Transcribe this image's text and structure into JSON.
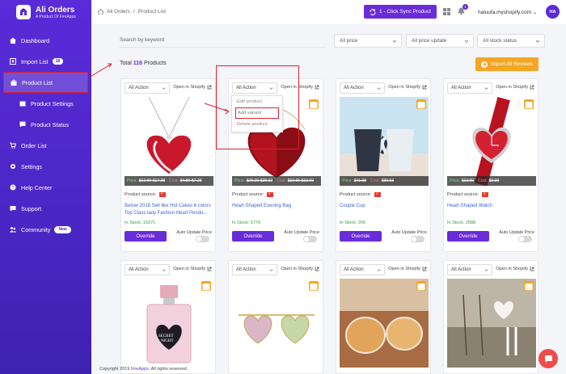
{
  "brand": {
    "title": "Ali Orders",
    "subtitle": "A Product Of FireApps"
  },
  "sidebar": {
    "items": [
      {
        "label": "Dashboard"
      },
      {
        "label": "Import List",
        "badge": "18"
      },
      {
        "label": "Product List"
      },
      {
        "label": "Product Settings"
      },
      {
        "label": "Product Status"
      },
      {
        "label": "Order List"
      },
      {
        "label": "Settings"
      },
      {
        "label": "Help Center"
      },
      {
        "label": "Support"
      },
      {
        "label": "Community",
        "badge": "New"
      }
    ]
  },
  "header": {
    "breadcrumb": [
      "All Orders",
      "Product List"
    ],
    "sync_label": "1 - Click Sync Product",
    "notification_count": "1",
    "shop": "haluufa.myshopify.com",
    "avatar": "HA"
  },
  "filters": {
    "search_placeholder": "Search by keyword",
    "price": "All price",
    "price_update": "All price update",
    "stock": "All stock status"
  },
  "summary": {
    "prefix": "Total",
    "count": "116",
    "suffix": "Products"
  },
  "import_reviews_label": "Import All Reviews",
  "card_common": {
    "action": "All Action",
    "open": "Open in Shopify",
    "source": "Product source:",
    "override": "Override",
    "auto_update": "Auto Update Price",
    "price_label": "Price:",
    "cost_label": "Cost:"
  },
  "dropdown": {
    "options": [
      "Edit product",
      "Add variant",
      "Delete product"
    ]
  },
  "products": [
    {
      "price": "$12.89-$17.28",
      "cost": "$4.89-$7.28",
      "title": "Belver 2018 Sell like Hot Cakes 6 colors Top Class lady Fashion Heart Pendo...",
      "stock": "In Stock: 16371"
    },
    {
      "price": "$28.20-$28.32",
      "cost": "$10.65-$10.69",
      "title": "Heart-Shaped Evening Bag",
      "stock": "In Stock: 5776"
    },
    {
      "price": "$41.08",
      "cost": "$30.53",
      "title": "Couple Cup",
      "stock": "In Stock: 200"
    },
    {
      "price": "$13.99",
      "cost": "$3.99",
      "title": "Heart-Shaped Watch",
      "stock": "In Stock: 2588"
    },
    {},
    {},
    {},
    {}
  ],
  "footer": {
    "text": "Copyright 2019",
    "link": "FireApps",
    "rest": ". All rights reserved."
  },
  "colors": {
    "primary": "#6a2bd9",
    "accent": "#f5a623",
    "annotation": "#e0202a"
  }
}
